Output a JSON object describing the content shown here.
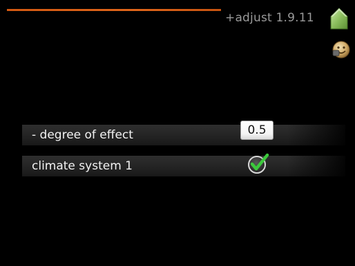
{
  "header": {
    "title": "+adjust 1.9.11"
  },
  "icons": {
    "home": "house-icon",
    "help": "smiley-face-icon"
  },
  "colors": {
    "accent": "#e0661a",
    "check_green": "#3cc83c"
  },
  "settings": {
    "rows": [
      {
        "label": "- degree of effect",
        "value": "0.5"
      },
      {
        "label": "climate system 1",
        "checked": true
      }
    ]
  }
}
